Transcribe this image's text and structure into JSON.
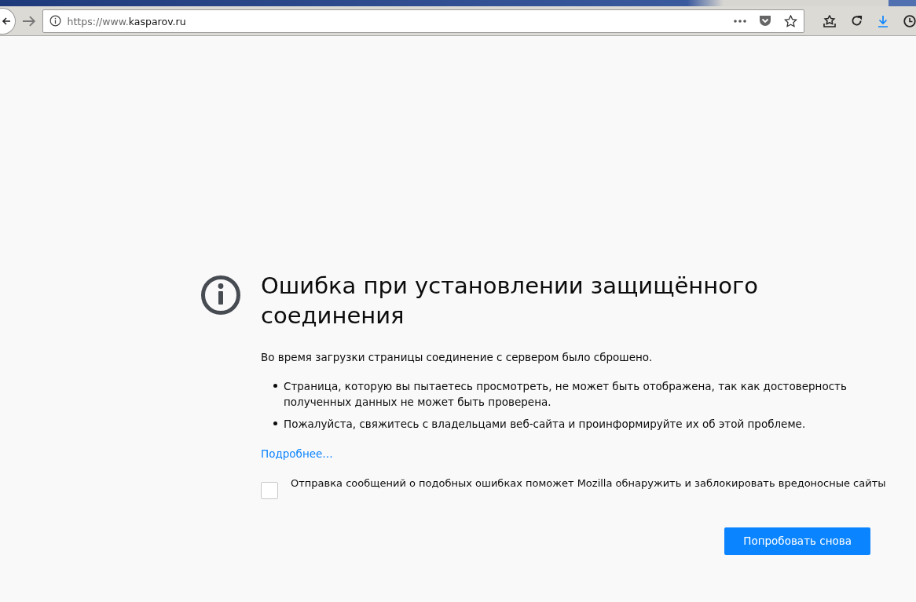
{
  "address_bar": {
    "url_prefix": "https://www.",
    "url_domain": "kasparov.ru"
  },
  "error": {
    "title": "Ошибка при установлении защищённого соединения",
    "description": "Во время загрузки страницы соединение с сервером было сброшено.",
    "bullets": [
      "Страница, которую вы пытаетесь просмотреть, не может быть отображена, так как достоверность полученных данных не может быть проверена.",
      "Пожалуйста, свяжитесь с владельцами веб-сайта и проинформируйте их об этой проблеме."
    ],
    "learn_more": "Подробнее…",
    "report_checkbox": {
      "label": "Отправка сообщений о подобных ошибках поможет Mozilla обнаружить и заблокировать вредоносные сайты",
      "checked": false
    },
    "retry_button": "Попробовать снова"
  }
}
